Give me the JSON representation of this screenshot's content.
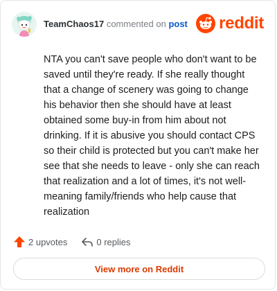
{
  "comment": {
    "username": "TeamChaos17",
    "action_text": "commented on",
    "post_link_text": "post",
    "body": "NTA you can't save people who don't want to be saved until they're ready. If she really thought that a change of scenery was going to change his behavior then she should have at least obtained some buy-in from him about not drinking. If it is abusive you should contact CPS so their child is protected but you can't make her see that she needs to leave - only she can reach that realization and a lot of times, it's not well-meaning family/friends who help cause that realization"
  },
  "brand": {
    "name": "reddit",
    "color": "#ff4500"
  },
  "stats": {
    "upvotes_label": "2 upvotes",
    "replies_label": "0 replies"
  },
  "footer": {
    "view_more_label": "View more on Reddit"
  },
  "icons": {
    "avatar": "snoo-avatar",
    "brand": "reddit-logo-icon",
    "upvote": "upvote-arrow-icon",
    "reply": "reply-arrow-icon"
  }
}
